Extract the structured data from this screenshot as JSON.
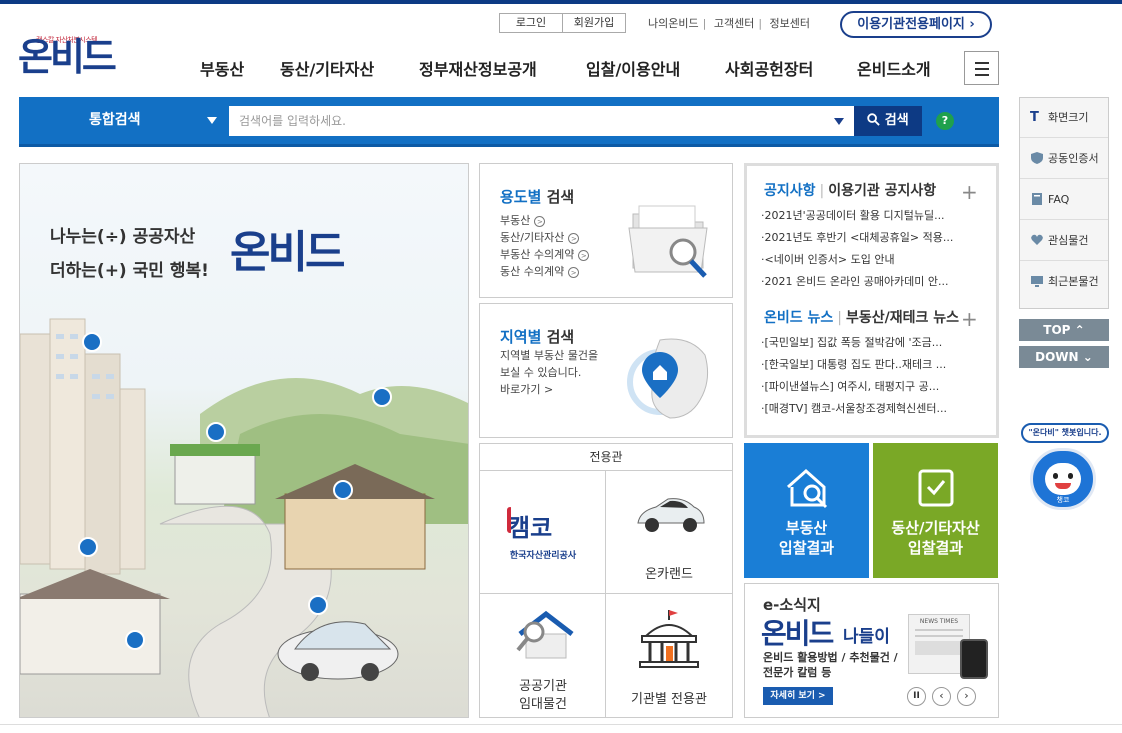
{
  "header": {
    "logo_tagline": "캠스칼 자산처분시스템",
    "logo_text": "온비드",
    "login": "로그인",
    "signup": "회원가입",
    "util_links": [
      "나의온비드",
      "고객센터",
      "정보센터"
    ],
    "agency_page": "이용기관전용페이지",
    "gnb": [
      "부동산",
      "동산/기타자산",
      "정부재산정보공개",
      "입찰/이용안내",
      "사회공헌장터",
      "온비드소개"
    ]
  },
  "search": {
    "category": "통합검색",
    "placeholder": "검색어를 입력하세요.",
    "button": "검색",
    "help": "?"
  },
  "main_visual": {
    "line1": "나누는(÷) 공공자산",
    "line2": "더하는(+) 국민 행복!",
    "logo": "온비드"
  },
  "usage_search": {
    "title_em": "용도별",
    "title_rest": " 검색",
    "items": [
      "부동산",
      "동산/기타자산",
      "부동산 수의계약",
      "동산 수의계약"
    ]
  },
  "region_search": {
    "title_em": "지역별",
    "title_rest": " 검색",
    "desc1": "지역별 부동산 물건을",
    "desc2": "보실 수 있습니다.",
    "link": "바로가기 >"
  },
  "notice": {
    "tab1": "공지사항",
    "tab2": "이용기관 공지사항",
    "items": [
      "·2021년'공공데이터 활용 디지털뉴딜...",
      "·2021년도 후반기 <대체공휴일> 적용...",
      "·<네이버 인증서> 도입 안내",
      "·2021 온비드 온라인 공매아카데미 안..."
    ]
  },
  "news": {
    "tab1": "온비드 뉴스",
    "tab2": "부동산/재테크 뉴스",
    "items": [
      "·[국민일보] 집값 폭등 절박감에 '조금...",
      "·[한국일보] 대통령 집도 판다..재테크 ...",
      "·[파이낸셜뉴스] 여주시, 태평지구 공...",
      "·[매경TV] 캠코-서울창조경제혁신센터..."
    ]
  },
  "dedicated": {
    "title": "전용관",
    "kamco_name": "캠코",
    "kamco_sub": "한국자산관리공사",
    "oncarland": "온카랜드",
    "public1": "공공기관",
    "public2": "임대물건",
    "agency_hall": "기관별 전용관"
  },
  "tiles": {
    "realestate1": "부동산",
    "realestate2": "입찰결과",
    "movable1": "동산/기타자산",
    "movable2": "입찰결과"
  },
  "esosik": {
    "title": "e-소식지",
    "logo": "온비드",
    "logo_rest": "나들이",
    "desc1": "온비드 활용방법 / 추천물건 /",
    "desc2": "전문가 칼럼 등",
    "button": "자세히 보기 >",
    "newspaper": "NEWS TIMES"
  },
  "sidebar": {
    "items": [
      "화면크기",
      "공동인증서",
      "FAQ",
      "관심물건",
      "최근본물건"
    ],
    "top": "TOP",
    "down": "DOWN"
  },
  "chatbot": {
    "bubble": "\"온다비\" 챗봇입니다.",
    "name": "챙코"
  },
  "colors": {
    "brand_navy": "#1a3f8c",
    "search_blue": "#1270c4",
    "tile_blue": "#1a7ed6",
    "tile_green": "#7aa826"
  }
}
